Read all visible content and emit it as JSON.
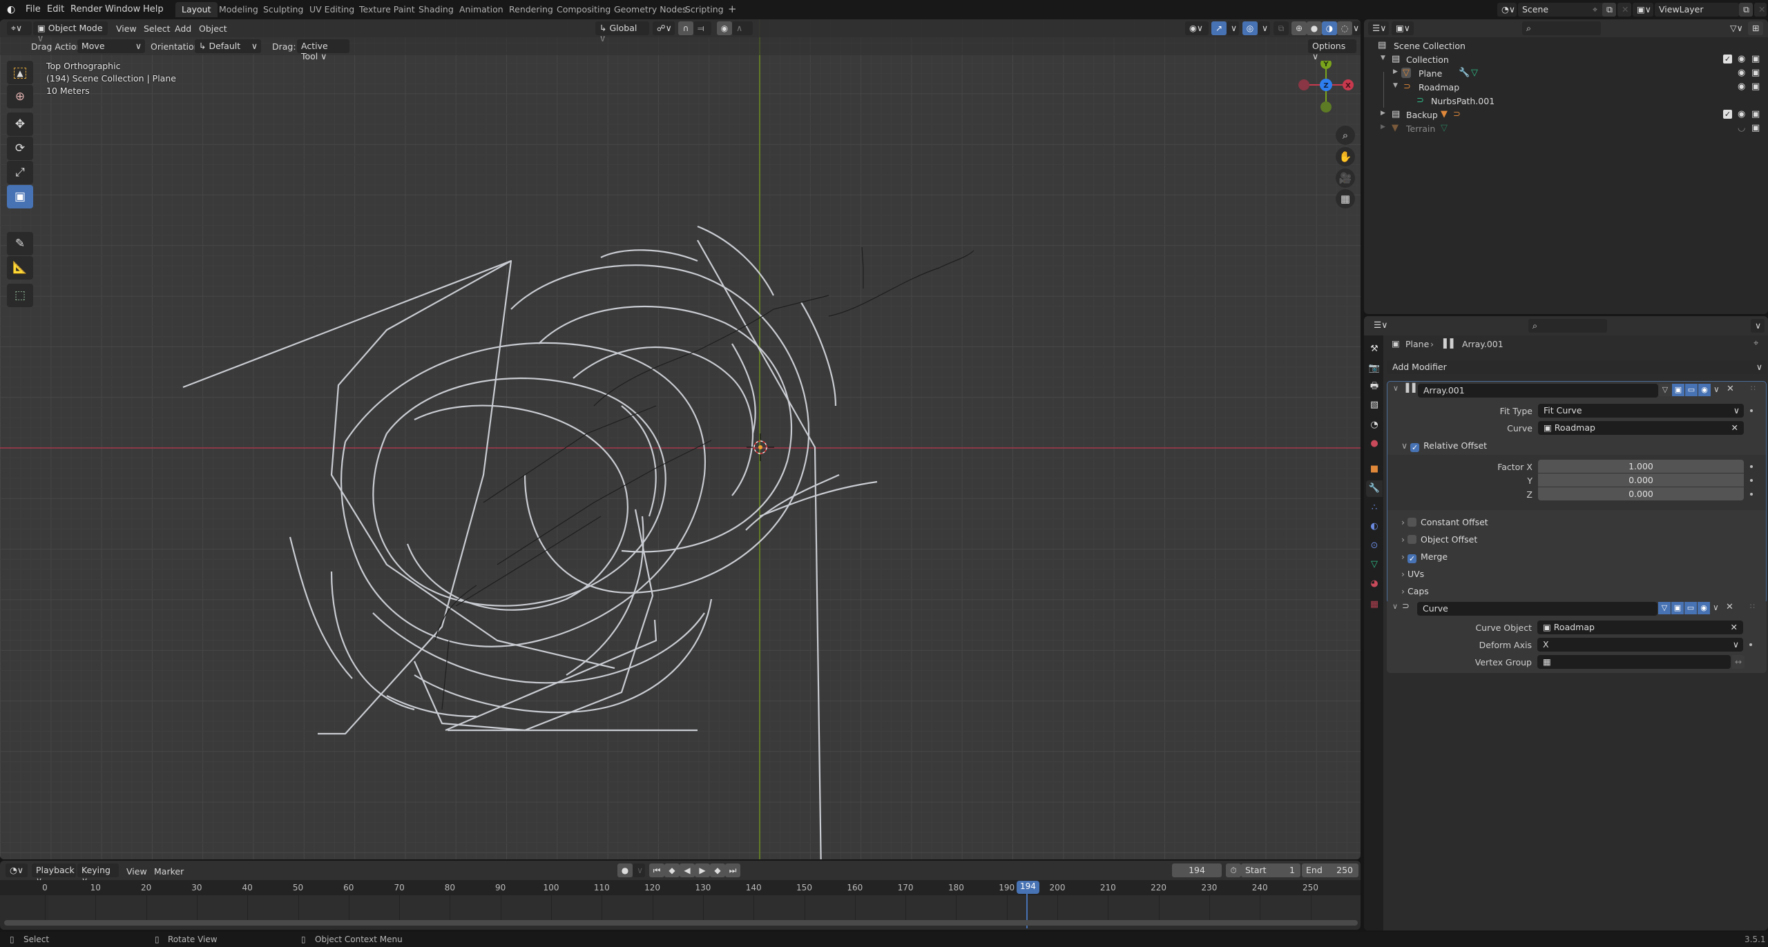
{
  "topbar": {
    "logo": "blender-logo-icon",
    "menus": [
      "File",
      "Edit",
      "Render",
      "Window",
      "Help"
    ],
    "workspaces": [
      "Layout",
      "Modeling",
      "Sculpting",
      "UV Editing",
      "Texture Paint",
      "Shading",
      "Animation",
      "Rendering",
      "Compositing",
      "Geometry Nodes",
      "Scripting"
    ],
    "active_workspace": "Layout",
    "add_workspace": "+",
    "scene": "Scene",
    "view_layer": "ViewLayer"
  },
  "viewport": {
    "header": {
      "mode": "Object Mode",
      "menus": [
        "View",
        "Select",
        "Add",
        "Object"
      ],
      "orientation": "Global",
      "options": "Options"
    },
    "tool_settings": {
      "drag_action_label": "Drag Action:",
      "drag_action_value": "Move",
      "orientation_label": "Orientation:",
      "orientation_value": "Default",
      "drag_label": "Drag:",
      "drag_value": "Active Tool"
    },
    "overlay": {
      "view_name": "Top Orthographic",
      "collection_info": "(194) Scene Collection | Plane",
      "scale": "10 Meters"
    },
    "gizmo": {
      "y": "Y",
      "z": "Z",
      "x": "X"
    },
    "colors": {
      "x_axis": "#c8394e",
      "y_axis": "#7aa41c",
      "z_axis": "#2e7ef0",
      "curve": "#c9ccd2",
      "active_tool": "#4772b3"
    }
  },
  "timeline": {
    "menus": [
      "Playback",
      "Keying",
      "View",
      "Marker"
    ],
    "current_frame": "194",
    "start_label": "Start",
    "start": "1",
    "end_label": "End",
    "end": "250",
    "ticks": [
      "0",
      "10",
      "20",
      "30",
      "40",
      "50",
      "60",
      "70",
      "80",
      "90",
      "100",
      "110",
      "120",
      "130",
      "140",
      "150",
      "160",
      "170",
      "180",
      "190",
      "200",
      "210",
      "220",
      "230",
      "240",
      "250"
    ],
    "playhead": "194"
  },
  "statusbar": {
    "items": [
      "Select",
      "Rotate View",
      "Object Context Menu"
    ],
    "version": "3.5.1"
  },
  "outliner": {
    "search_placeholder": "",
    "rows": [
      {
        "label": "Scene Collection"
      },
      {
        "label": "Collection"
      },
      {
        "label": "Plane"
      },
      {
        "label": "Roadmap"
      },
      {
        "label": "NurbsPath.001"
      },
      {
        "label": "Backup"
      },
      {
        "label": "Terrain"
      }
    ]
  },
  "properties": {
    "breadcrumb": {
      "object": "Plane",
      "modifier": "Array.001"
    },
    "add_modifier": "Add Modifier",
    "array": {
      "name": "Array.001",
      "fit_type_label": "Fit Type",
      "fit_type": "Fit Curve",
      "curve_label": "Curve",
      "curve": "Roadmap",
      "relative_offset": "Relative Offset",
      "factor_x_label": "Factor X",
      "factor_x": "1.000",
      "y_label": "Y",
      "y": "0.000",
      "z_label": "Z",
      "z": "0.000",
      "constant_offset": "Constant Offset",
      "object_offset": "Object Offset",
      "merge": "Merge",
      "uvs": "UVs",
      "caps": "Caps"
    },
    "curve_mod": {
      "name": "Curve",
      "curve_object_label": "Curve Object",
      "curve_object": "Roadmap",
      "deform_axis_label": "Deform Axis",
      "deform_axis": "X",
      "vertex_group_label": "Vertex Group",
      "vertex_group": ""
    }
  }
}
